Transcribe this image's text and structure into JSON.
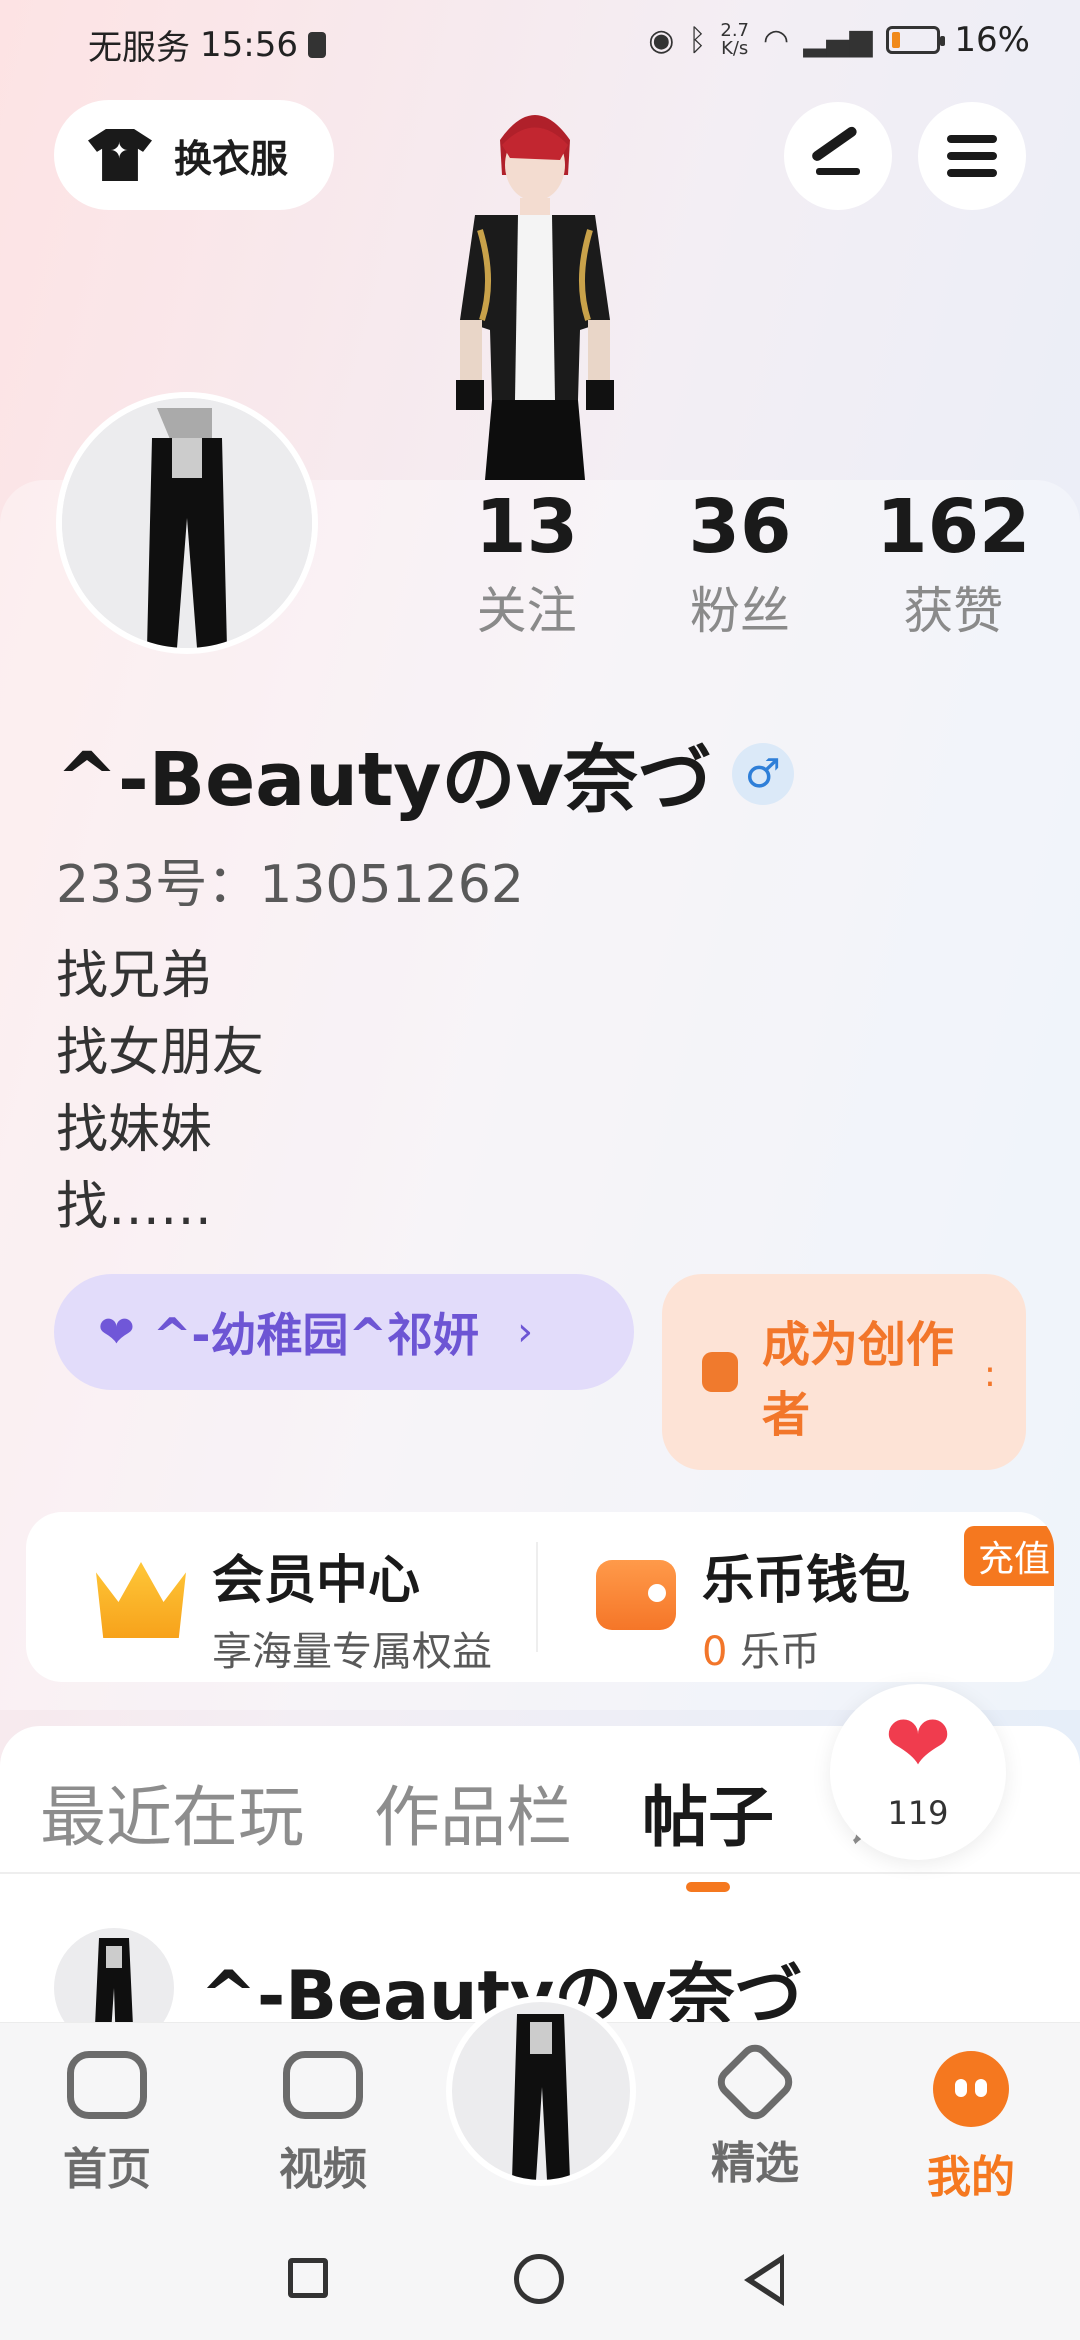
{
  "status_bar": {
    "carrier": "无服务",
    "time": "15:56",
    "speed_value": "2.7",
    "speed_unit": "K/s",
    "battery": "16%",
    "battery_level": 0.16
  },
  "top_buttons": {
    "outfit_label": "换衣服"
  },
  "profile": {
    "following_count": "13",
    "following_label": "关注",
    "fans_count": "36",
    "fans_label": "粉丝",
    "likes_count": "162",
    "likes_label": "获赞",
    "username": "^-Beautyのv奈づ",
    "gender_symbol": "♂",
    "id_text": "233号：13051262",
    "bio": [
      "找兄弟",
      "找女朋友",
      "找妹妹",
      "找……"
    ]
  },
  "guild": {
    "name": "^-幼稚园^祁妍",
    "chevron": "›"
  },
  "creator": {
    "label": "成为创作者",
    "dot": ":"
  },
  "vip": {
    "title": "会员中心",
    "subtitle": "享海量专属权益"
  },
  "wallet": {
    "title": "乐币钱包",
    "amount": "0",
    "unit": "乐币",
    "recharge": "充值"
  },
  "tabs": [
    {
      "label": "最近在玩"
    },
    {
      "label": "作品栏"
    },
    {
      "label": "帖子"
    },
    {
      "label": "评论"
    }
  ],
  "like_bubble": {
    "count": "119"
  },
  "post": {
    "author": "^-Beautyのv奈づ"
  },
  "bottom_nav": [
    {
      "label": "首页"
    },
    {
      "label": "视频"
    },
    {
      "label": "精选"
    },
    {
      "label": "我的"
    }
  ],
  "colors": {
    "accent": "#f5781f",
    "guild_text": "#6d55d4",
    "heart": "#f03c4e"
  }
}
